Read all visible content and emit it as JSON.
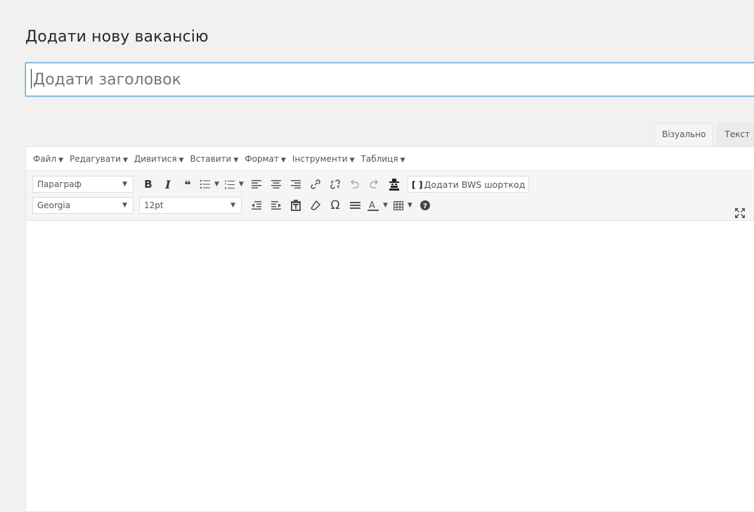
{
  "page": {
    "title": "Додати нову вакансію"
  },
  "title_input": {
    "placeholder": "Додати заголовок"
  },
  "editor_tabs": {
    "visual": "Візуально",
    "text": "Текст"
  },
  "menubar": [
    {
      "label": "Файл"
    },
    {
      "label": "Редагувати"
    },
    {
      "label": "Дивитися"
    },
    {
      "label": "Вставити"
    },
    {
      "label": "Формат"
    },
    {
      "label": "Інструменти"
    },
    {
      "label": "Таблиця"
    }
  ],
  "toolbar": {
    "format_select": "Параграф",
    "font_select": "Georgia",
    "size_select": "12pt",
    "bold": "B",
    "italic": "I",
    "blockquote": "❝",
    "omega": "Ω",
    "shortcode_bracket": "[ ]",
    "shortcode_label": "Додати BWS шорткод"
  },
  "colors": {
    "accent": "#5b9dd9",
    "background": "#f1f1f1",
    "toolbar_bg": "#f5f5f5",
    "icon": "#555555"
  },
  "icons": [
    "bold-icon",
    "italic-icon",
    "quote-icon",
    "bullet-list-icon",
    "numbered-list-icon",
    "align-left-icon",
    "align-center-icon",
    "align-right-icon",
    "link-icon",
    "unlink-icon",
    "undo-icon",
    "redo-icon",
    "spy-icon",
    "fullscreen-icon",
    "outdent-icon",
    "indent-icon",
    "paste-text-icon",
    "eraser-icon",
    "omega-icon",
    "hr-icon",
    "text-color-icon",
    "table-icon",
    "help-icon"
  ]
}
